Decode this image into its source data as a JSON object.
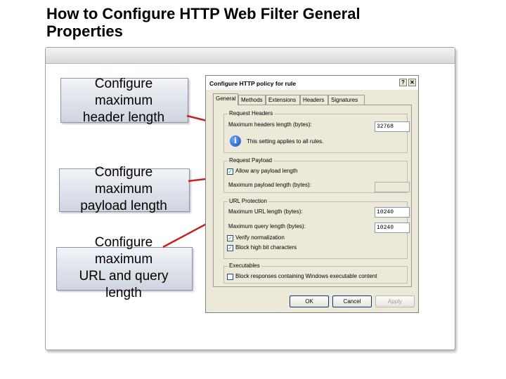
{
  "slide": {
    "title_line1": "How to Configure HTTP Web Filter General",
    "title_line2": "Properties"
  },
  "callouts": [
    {
      "lines": [
        "Configure",
        "maximum",
        "header length"
      ]
    },
    {
      "lines": [
        "Configure",
        "maximum",
        "payload length"
      ]
    },
    {
      "lines": [
        "Configure",
        "maximum",
        "URL and query",
        "length"
      ]
    }
  ],
  "colors": {
    "connector": "#cc1f1f",
    "callout_border": "#8a96a8"
  },
  "dialog": {
    "title": "Configure HTTP policy for rule",
    "help_icon": "help-icon",
    "close_icon": "close-icon",
    "tabs": [
      "General",
      "Methods",
      "Extensions",
      "Headers",
      "Signatures"
    ],
    "request_headers": {
      "legend": "Request Headers",
      "max_headers_label": "Maximum headers length (bytes):",
      "max_headers_value": "32768",
      "info_text": "This setting applies to all rules."
    },
    "request_payload": {
      "legend": "Request Payload",
      "allow_any_label": "Allow any payload length",
      "allow_any_checked": true,
      "max_payload_label": "Maximum payload length (bytes):",
      "max_payload_value": ""
    },
    "url_protection": {
      "legend": "URL Protection",
      "max_url_label": "Maximum URL length (bytes):",
      "max_url_value": "10240",
      "max_query_label": "Maximum query length (bytes):",
      "max_query_value": "10240",
      "verify_norm_label": "Verify normalization",
      "verify_norm_checked": true,
      "block_high_bit_label": "Block high bit characters",
      "block_high_bit_checked": true
    },
    "executables": {
      "legend": "Executables",
      "block_label": "Block responses containing Windows executable content",
      "block_checked": false
    },
    "buttons": {
      "ok": "OK",
      "cancel": "Cancel",
      "apply": "Apply"
    }
  }
}
